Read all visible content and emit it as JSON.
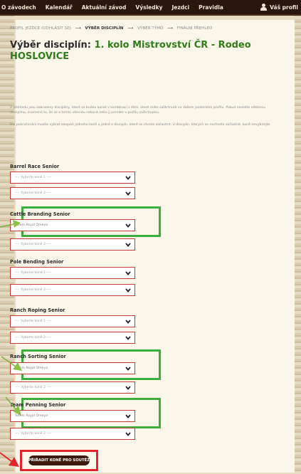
{
  "nav": {
    "items": [
      "O závodech",
      "Kalendář",
      "Aktuální závod",
      "Výsledky",
      "Jezdci",
      "Pravidla"
    ],
    "profile": "Váš profil"
  },
  "breadcrumb": {
    "step1": "PROFIL JEZDCE (ODHLÁSIT SE)",
    "step2": "VÝBĚR DISCIPLÍN",
    "step3": "VÝBĚR TÝMŮ",
    "step4": "FINÁLNÍ PŘEHLED"
  },
  "title": {
    "prefix": "Výběr disciplín: ",
    "event_line1": "1. kolo Mistrovství ČR - Rodeo",
    "event_line2": "HOSLOVICE"
  },
  "description": {
    "p1": "V přehledu jsou zobrazeny disciplíny, které se budou konat v kombinaci s ětmi, které máte zaškrtnuté ve Vašem jezdeckém profilu. Pokud nevidíte některou disciplínu, znamená to, že se o tomto víkendu nekoná nebo ji nemáte v profilu zaškrtnutou.",
    "p2": "Pro pokračování musíte vybrat alespoň jednoho koně u jedné z disciplín, které se chcete zúčastnit. U disciplín, kterých se nechcete zúčastnit, koně nevybírejte."
  },
  "disciplines": [
    {
      "name": "Barrel Race Senior",
      "horse1": "---- Vyberte koně 1 ----",
      "horse2": "---- Vyberte koně 2 ----",
      "horse1_selected": false
    },
    {
      "name": "Cattle Branding Senior",
      "horse1": "Totem Royal Omeya",
      "horse2": "---- Vyberte koně 2 ----",
      "horse1_selected": true
    },
    {
      "name": "Pole Bending Senior",
      "horse1": "---- Vyberte koně 1 ----",
      "horse2": "---- Vyberte koně 2 ----",
      "horse1_selected": false
    },
    {
      "name": "Ranch Roping Senior",
      "horse1": "---- Vyberte koně 1 ----",
      "horse2": "---- Vyberte koně 2 ----",
      "horse1_selected": false
    },
    {
      "name": "Ranch Sorting Senior",
      "horse1": "Totem Royal Omeya",
      "horse2": "---- Vyberte koně 2 ----",
      "horse1_selected": true
    },
    {
      "name": "Team Penning Senior",
      "horse1": "Totem Royal Omeya",
      "horse2": "---- Vyberte koně 2 ----",
      "horse1_selected": true
    }
  ],
  "submit_label": "PŘIŘADIT KONĚ PRO SOUTĚŽ",
  "colors": {
    "nav_bg": "#2a160c",
    "title_accent": "#2f7d1a",
    "select_border": "#c23a3a",
    "highlight_green": "#3cae3f",
    "highlight_red": "#e0262a",
    "button_bg": "#3b1a0d"
  }
}
